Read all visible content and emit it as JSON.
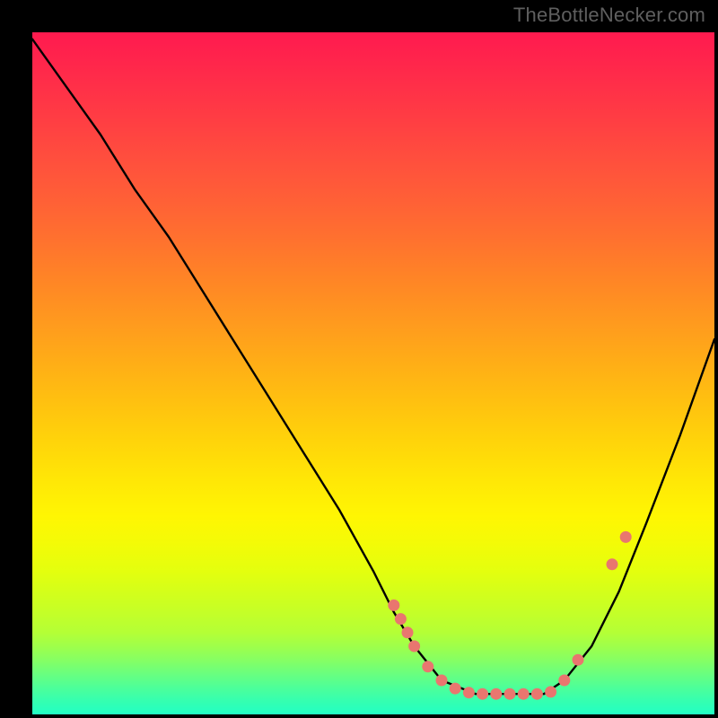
{
  "watermark": "TheBottleNecker.com",
  "chart_data": {
    "type": "line",
    "title": "",
    "xlabel": "",
    "ylabel": "",
    "xlim": [
      0,
      100
    ],
    "ylim": [
      0,
      100
    ],
    "notes": "Unlabeled bottleneck-curve plot on a vertical red→yellow→green gradient. Lower y is better. A black curve descends from near the top-left, reaches a flat minimum around x≈60–75 at y≈3, then rises again toward the right. Salmon-colored dots mark sampled points near the trough and on both rising flanks.",
    "series": [
      {
        "name": "curve",
        "x": [
          0,
          5,
          10,
          15,
          20,
          25,
          30,
          35,
          40,
          45,
          50,
          53,
          56,
          60,
          65,
          70,
          75,
          78,
          82,
          86,
          90,
          95,
          100
        ],
        "y": [
          99,
          92,
          85,
          77,
          70,
          62,
          54,
          46,
          38,
          30,
          21,
          15,
          10,
          5,
          3,
          3,
          3,
          5,
          10,
          18,
          28,
          41,
          55
        ]
      }
    ],
    "markers": {
      "name": "samples",
      "color": "#e9766f",
      "x": [
        53,
        54,
        55,
        56,
        58,
        60,
        62,
        64,
        66,
        68,
        70,
        72,
        74,
        76,
        78,
        80,
        85,
        87
      ],
      "y": [
        16,
        14,
        12,
        10,
        7,
        5,
        3.8,
        3.2,
        3,
        3,
        3,
        3,
        3,
        3.3,
        5,
        8,
        22,
        26
      ]
    }
  }
}
